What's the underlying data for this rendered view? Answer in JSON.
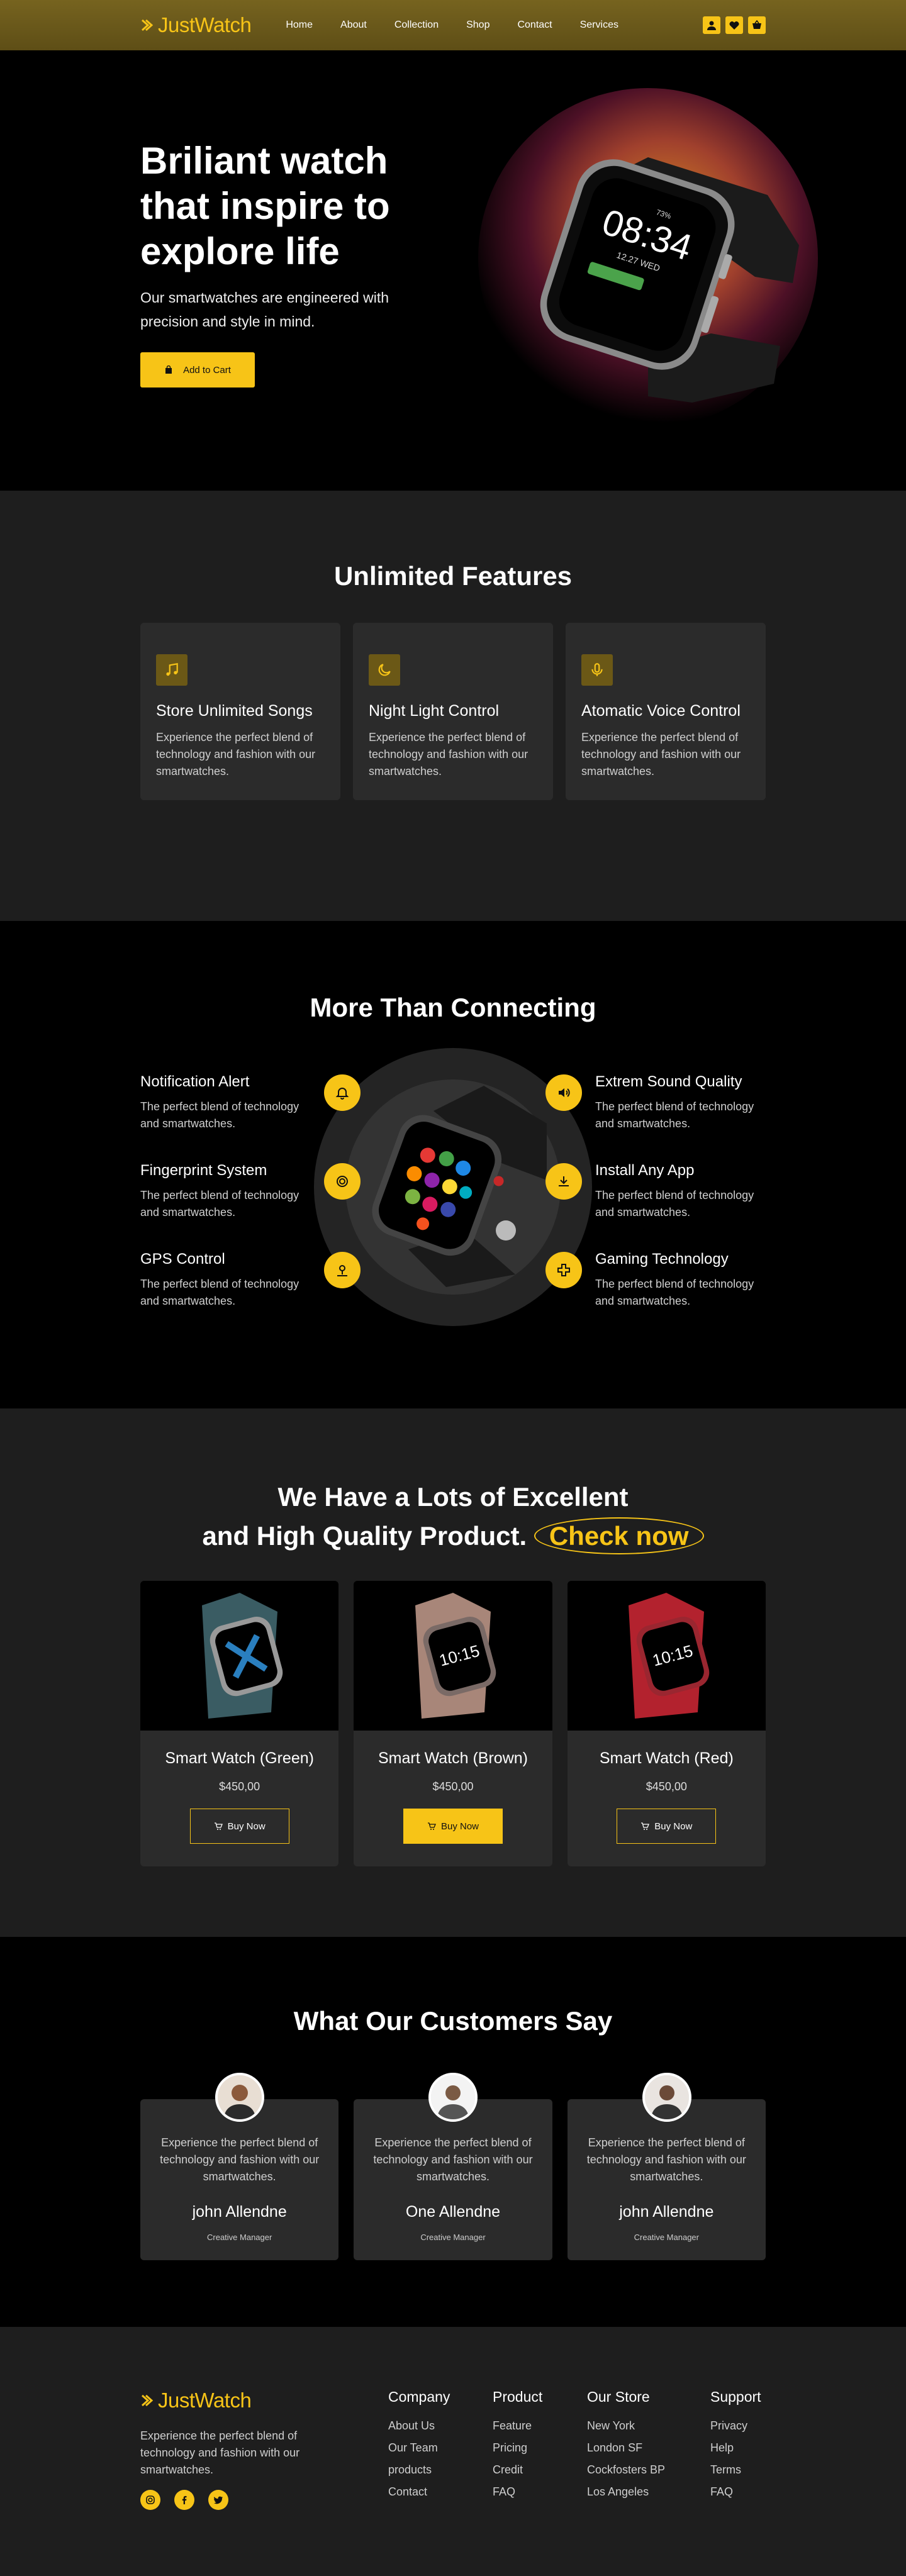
{
  "colors": {
    "accent": "#f7c417",
    "nav_bg": "#6b5a1b",
    "section_dark": "#1e1e1e",
    "card": "#2b2b2b"
  },
  "nav": {
    "logo": "JustWatch",
    "links": [
      "Home",
      "About",
      "Collection",
      "Shop",
      "Contact",
      "Services"
    ],
    "icons": [
      "user-icon",
      "heart-icon",
      "cart-icon"
    ]
  },
  "hero": {
    "title": "Briliant watch that inspire to explore life",
    "subtitle": "Our smartwatches are engineered with precision and style in mind.",
    "cta": "Add to Cart",
    "watch_time": "08:34",
    "watch_date": "12.27 WED",
    "watch_battery": "73%"
  },
  "features": {
    "title": "Unlimited Features",
    "items": [
      {
        "icon": "music-icon",
        "title": "Store Unlimited Songs",
        "text": "Experience the perfect blend of technology and fashion with our smartwatches."
      },
      {
        "icon": "moon-icon",
        "title": "Night Light Control",
        "text": "Experience the perfect blend of technology and fashion with our smartwatches."
      },
      {
        "icon": "microphone-icon",
        "title": "Atomatic Voice Control",
        "text": "Experience the perfect blend of technology and fashion with our smartwatches."
      }
    ]
  },
  "connecting": {
    "title": "More Than Connecting",
    "left": [
      {
        "icon": "bell-icon",
        "title": "Notification Alert",
        "text": "The perfect blend of technology and smartwatches."
      },
      {
        "icon": "fingerprint-icon",
        "title": "Fingerprint System",
        "text": "The perfect blend of technology and smartwatches."
      },
      {
        "icon": "location-icon",
        "title": "GPS Control",
        "text": "The perfect blend of technology and smartwatches."
      }
    ],
    "right": [
      {
        "icon": "speaker-icon",
        "title": "Extrem Sound Quality",
        "text": "The perfect blend of technology and smartwatches."
      },
      {
        "icon": "download-icon",
        "title": "Install Any App",
        "text": "The perfect blend of technology and smartwatches."
      },
      {
        "icon": "gamepad-icon",
        "title": "Gaming Technology",
        "text": "The perfect blend of technology and smartwatches."
      }
    ]
  },
  "products": {
    "title_line1": "We Have a Lots of Excellent",
    "title_line2": "and High Quality Product.",
    "highlight": "Check now",
    "items": [
      {
        "name": "Smart Watch (Green)",
        "price": "$450,00",
        "button": "Buy Now",
        "strap": "#3a5c63"
      },
      {
        "name": "Smart Watch (Brown)",
        "price": "$450,00",
        "button": "Buy Now",
        "strap": "#a88679"
      },
      {
        "name": "Smart Watch (Red)",
        "price": "$450,00",
        "button": "Buy Now",
        "strap": "#b3222e"
      }
    ]
  },
  "testimonials": {
    "title": "What Our Customers Say",
    "items": [
      {
        "text": "Experience the perfect blend of technology and fashion with our smartwatches.",
        "name": "john Allendne",
        "role": "Creative Manager"
      },
      {
        "text": "Experience the perfect blend of technology and fashion with our smartwatches.",
        "name": "One Allendne",
        "role": "Creative Manager"
      },
      {
        "text": "Experience the perfect blend of technology and fashion with our smartwatches.",
        "name": "john Allendne",
        "role": "Creative Manager"
      }
    ]
  },
  "footer": {
    "logo": "JustWatch",
    "text": "Experience the perfect blend of technology and fashion with our smartwatches.",
    "socials": [
      "instagram-icon",
      "facebook-icon",
      "twitter-icon"
    ],
    "columns": [
      {
        "title": "Company",
        "links": [
          "About Us",
          "Our Team",
          "products",
          "Contact"
        ]
      },
      {
        "title": "Product",
        "links": [
          "Feature",
          "Pricing",
          "Credit",
          "FAQ"
        ]
      },
      {
        "title": "Our Store",
        "links": [
          "New York",
          "London SF",
          "Cockfosters BP",
          "Los Angeles"
        ]
      },
      {
        "title": "Support",
        "links": [
          "Privacy",
          "Help",
          "Terms",
          "FAQ"
        ]
      }
    ]
  }
}
